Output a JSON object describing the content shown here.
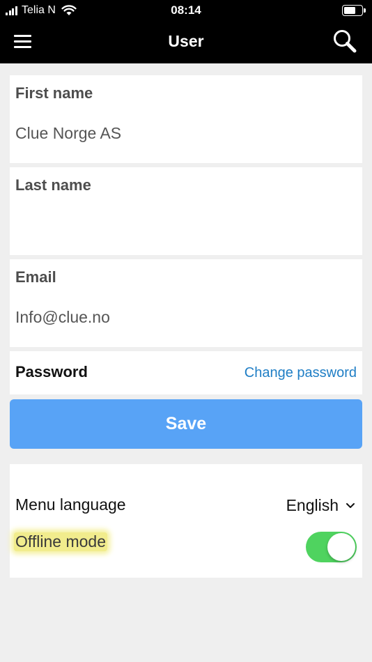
{
  "status_bar": {
    "carrier": "Telia N",
    "time": "08:14",
    "icons": [
      "signal-icon",
      "wifi-icon",
      "battery-icon"
    ]
  },
  "nav": {
    "title": "User",
    "icons": [
      "hamburger-menu-icon",
      "search-icon"
    ]
  },
  "form": {
    "first_name": {
      "label": "First name",
      "value": "Clue Norge AS"
    },
    "last_name": {
      "label": "Last name",
      "value": ""
    },
    "email": {
      "label": "Email",
      "value": "Info@clue.no"
    },
    "password": {
      "label": "Password",
      "link": "Change password"
    },
    "save_label": "Save"
  },
  "settings": {
    "menu_language": {
      "label": "Menu language",
      "value": "English"
    },
    "offline_mode": {
      "label": "Offline mode",
      "enabled": true
    }
  },
  "colors": {
    "nav_background": "#000000",
    "save_button": "#58a3f6",
    "link": "#1f7ec5",
    "toggle_on": "#4fd35f",
    "highlight": "#f1ec8d",
    "page_background": "#efefef"
  }
}
